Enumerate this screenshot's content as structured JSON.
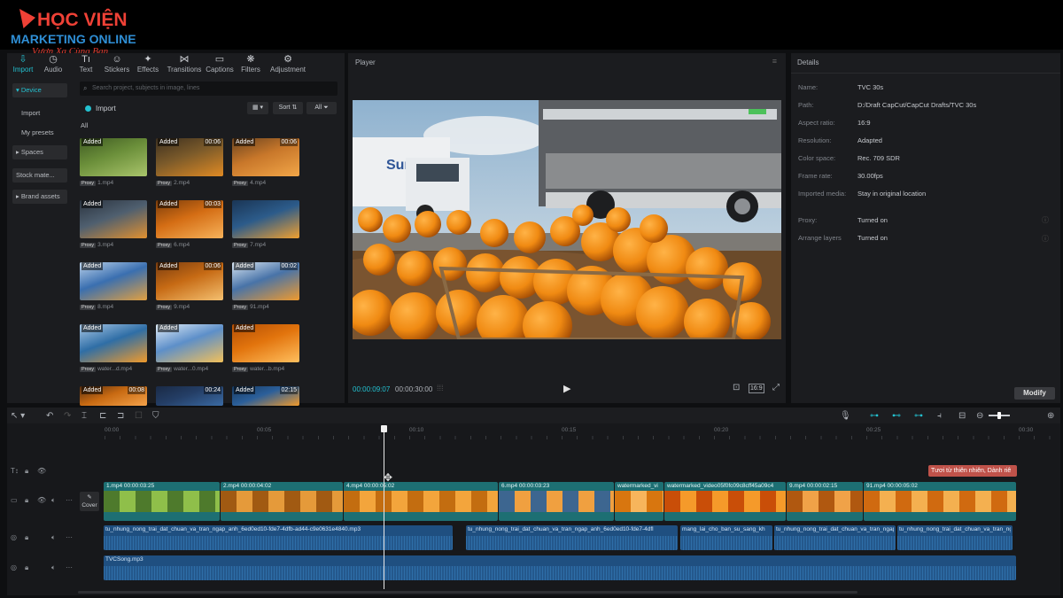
{
  "watermark": {
    "line1": "HỌC VIỆN",
    "line2": "MARKETING ONLINE",
    "tagline": "Vươn Xa Cùng Bạn"
  },
  "left_panel": {
    "tabs": [
      {
        "label": "Import",
        "icon": "import-icon"
      },
      {
        "label": "Audio",
        "icon": "audio-icon"
      },
      {
        "label": "Text",
        "icon": "text-icon"
      },
      {
        "label": "Stickers",
        "icon": "stickers-icon"
      },
      {
        "label": "Effects",
        "icon": "effects-icon"
      },
      {
        "label": "Transitions",
        "icon": "transitions-icon"
      },
      {
        "label": "Captions",
        "icon": "captions-icon"
      },
      {
        "label": "Filters",
        "icon": "filters-icon"
      },
      {
        "label": "Adjustment",
        "icon": "adjustment-icon"
      }
    ],
    "nav": [
      {
        "label": "▾ Device"
      },
      {
        "label": "Import"
      },
      {
        "label": "My presets"
      },
      {
        "label": "▸ Spaces"
      },
      {
        "label": "Stock mate..."
      },
      {
        "label": "▸ Brand assets"
      }
    ],
    "search_placeholder": "Search project, subjects in image, lines",
    "import_label": "Import",
    "sort_label": "Sort",
    "filter_all_button": "All",
    "filter_all_heading": "All",
    "media": [
      {
        "badge": "Added",
        "duration": "",
        "name": "1.mp4"
      },
      {
        "badge": "Added",
        "duration": "00:06",
        "name": "2.mp4"
      },
      {
        "badge": "Added",
        "duration": "00:06",
        "name": "4.mp4"
      },
      {
        "badge": "Added",
        "duration": "",
        "name": "3.mp4"
      },
      {
        "badge": "Added",
        "duration": "00:03",
        "name": "6.mp4"
      },
      {
        "badge": "",
        "duration": "",
        "name": "7.mp4"
      },
      {
        "badge": "Added",
        "duration": "",
        "name": "8.mp4"
      },
      {
        "badge": "Added",
        "duration": "00:06",
        "name": "9.mp4"
      },
      {
        "badge": "Added",
        "duration": "00:02",
        "name": "91.mp4"
      },
      {
        "badge": "Added",
        "duration": "",
        "name": "water...d.mp4"
      },
      {
        "badge": "Added",
        "duration": "",
        "name": "water...0.mp4"
      },
      {
        "badge": "Added",
        "duration": "",
        "name": "water...b.mp4"
      },
      {
        "badge": "Added",
        "duration": "00:08",
        "name": ""
      },
      {
        "badge": "",
        "duration": "00:24",
        "name": ""
      },
      {
        "badge": "Added",
        "duration": "02:15",
        "name": ""
      }
    ],
    "proxy_label": "Proxy"
  },
  "player": {
    "title": "Player",
    "current_time": "00:00:09:07",
    "total_time": "00:00:30:00",
    "ratio_label": "16:9"
  },
  "details": {
    "title": "Details",
    "rows": [
      {
        "key": "Name:",
        "value": "TVC 30s"
      },
      {
        "key": "Path:",
        "value": "D:/Draft CapCut/CapCut Drafts/TVC 30s"
      },
      {
        "key": "Aspect ratio:",
        "value": "16:9"
      },
      {
        "key": "Resolution:",
        "value": "Adapted"
      },
      {
        "key": "Color space:",
        "value": "Rec. 709 SDR"
      },
      {
        "key": "Frame rate:",
        "value": "30.00fps"
      },
      {
        "key": "Imported media:",
        "value": "Stay in original location"
      },
      {
        "key": "Proxy:",
        "value": "Turned on"
      },
      {
        "key": "Arrange layers",
        "value": "Turned on"
      }
    ],
    "modify_button": "Modify"
  },
  "timeline": {
    "ruler": [
      "00:00",
      "00:05",
      "00:10",
      "00:15",
      "00:20",
      "00:25",
      "00:30"
    ],
    "text_clip": "Tươi từ thiên nhiên, Dành riê",
    "cover_label": "Cover",
    "video_clips": [
      {
        "label": "1.mp4   00:00:03:25"
      },
      {
        "label": "2.mp4   00:00:04:02"
      },
      {
        "label": "4.mp4   00:00:05:02"
      },
      {
        "label": "6.mp4   00:00:03:23"
      },
      {
        "label": "watermarked_vi"
      },
      {
        "label": "watermarked_video05f0fc09c8cff45a09c4"
      },
      {
        "label": "9.mp4   00:00:02:15"
      },
      {
        "label": "91.mp4   00:00:05:02"
      }
    ],
    "audio_clips": [
      {
        "label": "tu_nhung_nong_trai_dat_chuan_va_tran_ngap_anh_6ed0ed10-fde7-4dfb-ad44-c9e0631e4840.mp3"
      },
      {
        "label": "tu_nhung_nong_trai_dat_chuan_va_tran_ngap_anh_6ed0ed10-fde7-4dfl"
      },
      {
        "label": "mang_lai_cho_ban_su_sang_kh"
      },
      {
        "label": "tu_nhung_nong_trai_dat_chuan_va_tran_ngap_a"
      },
      {
        "label": "tu_nhung_nong_trai_dat_chuan_va_tran_ngap_a"
      }
    ],
    "music_clip": "TVCSong.mp3"
  },
  "colors": {
    "accent": "#23c1d0",
    "video_track": "#1d6f73",
    "audio_track": "#1f4f80",
    "text_clip": "#c0524a"
  }
}
